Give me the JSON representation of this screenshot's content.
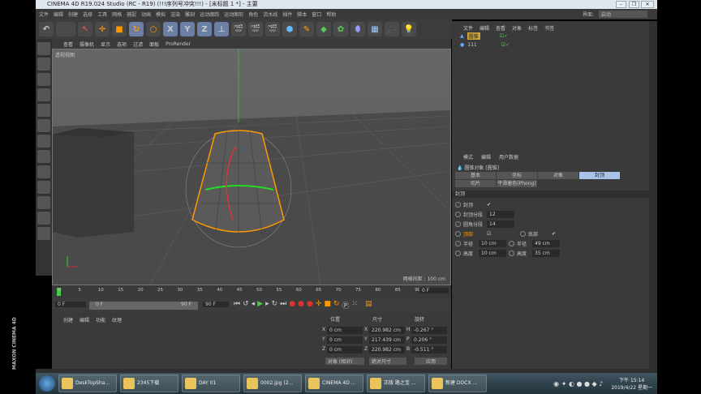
{
  "window": {
    "title": "CINEMA 4D R19.024 Studio (RC - R19) (!!!序列号冲突!!!) - [未标题 1 *] - 主要"
  },
  "menu": [
    "文件",
    "编辑",
    "创建",
    "选择",
    "工具",
    "网格",
    "捕捉",
    "动画",
    "模拟",
    "渲染",
    "雕刻",
    "运动跟踪",
    "运动图形",
    "角色",
    "流水线",
    "插件",
    "脚本",
    "窗口",
    "帮助"
  ],
  "layout": {
    "label": "界面:",
    "value": "启动"
  },
  "toolbar": {
    "x": "X",
    "y": "Y",
    "z": "Z"
  },
  "viewport": {
    "menu": [
      "查看",
      "摄像机",
      "显示",
      "选项",
      "过滤",
      "面板",
      "ProRender"
    ],
    "name": "透视视图",
    "grid": "网格间距 : 100 cm"
  },
  "object_manager": {
    "menu": [
      "文件",
      "编辑",
      "查看",
      "对象",
      "标签",
      "书签"
    ],
    "objects": [
      "圆锥",
      "111"
    ]
  },
  "attributes": {
    "menu": [
      "模式",
      "编辑",
      "用户数据"
    ],
    "object": "圆锥对象 [圆锥]",
    "tabs": [
      "基本",
      "坐标",
      "对象",
      "封顶",
      "切片",
      "平滑着色(Phong)"
    ],
    "section": "封顶",
    "cap": "封顶",
    "cap_check": "✔",
    "cap_seg_label": "封顶分段",
    "cap_seg": "12",
    "fillet_seg_label": "圆角分段",
    "fillet_seg": "14",
    "top": "顶部",
    "bottom": "底部",
    "bottom_check": "✔",
    "radius_label": "半径",
    "top_radius": "10 cm",
    "bottom_radius": "49 cm",
    "height_label": "高度",
    "top_height": "10 cm",
    "bottom_height": "35 cm"
  },
  "timeline": {
    "ticks": [
      "0",
      "5",
      "10",
      "15",
      "20",
      "25",
      "30",
      "35",
      "40",
      "45",
      "50",
      "55",
      "60",
      "65",
      "70",
      "75",
      "80",
      "85",
      "90"
    ],
    "current": "0 F",
    "start": "0 F",
    "range_start": "0 F",
    "range_end": "90 F",
    "end": "90 F"
  },
  "material": {
    "menu": [
      "创建",
      "编辑",
      "功能",
      "纹理"
    ],
    "logo": "MAXON CINEMA 4D"
  },
  "coordinates": {
    "headers": [
      "位置",
      "尺寸",
      "旋转"
    ],
    "rows": [
      [
        "X",
        "0 cm",
        "X",
        "220.982 cm",
        "H",
        "-0.267 °"
      ],
      [
        "Y",
        "0 cm",
        "Y",
        "217.439 cm",
        "P",
        "0.206 °"
      ],
      [
        "Z",
        "0 cm",
        "Z",
        "220.982 cm",
        "B",
        "-0.511 °"
      ]
    ],
    "mode": "对象 (相对)",
    "size_mode": "绝对尺寸",
    "apply": "应用"
  },
  "taskbar": {
    "items": [
      "DeskTopSha...",
      "2345下载",
      "DAY 01",
      "0002.jpg (2...",
      "CINEMA 4D ...",
      "正版 路之宝 ...",
      "新建 DOCX ..."
    ],
    "time": "下午 15:14",
    "date": "2019/4/22 星期一"
  }
}
